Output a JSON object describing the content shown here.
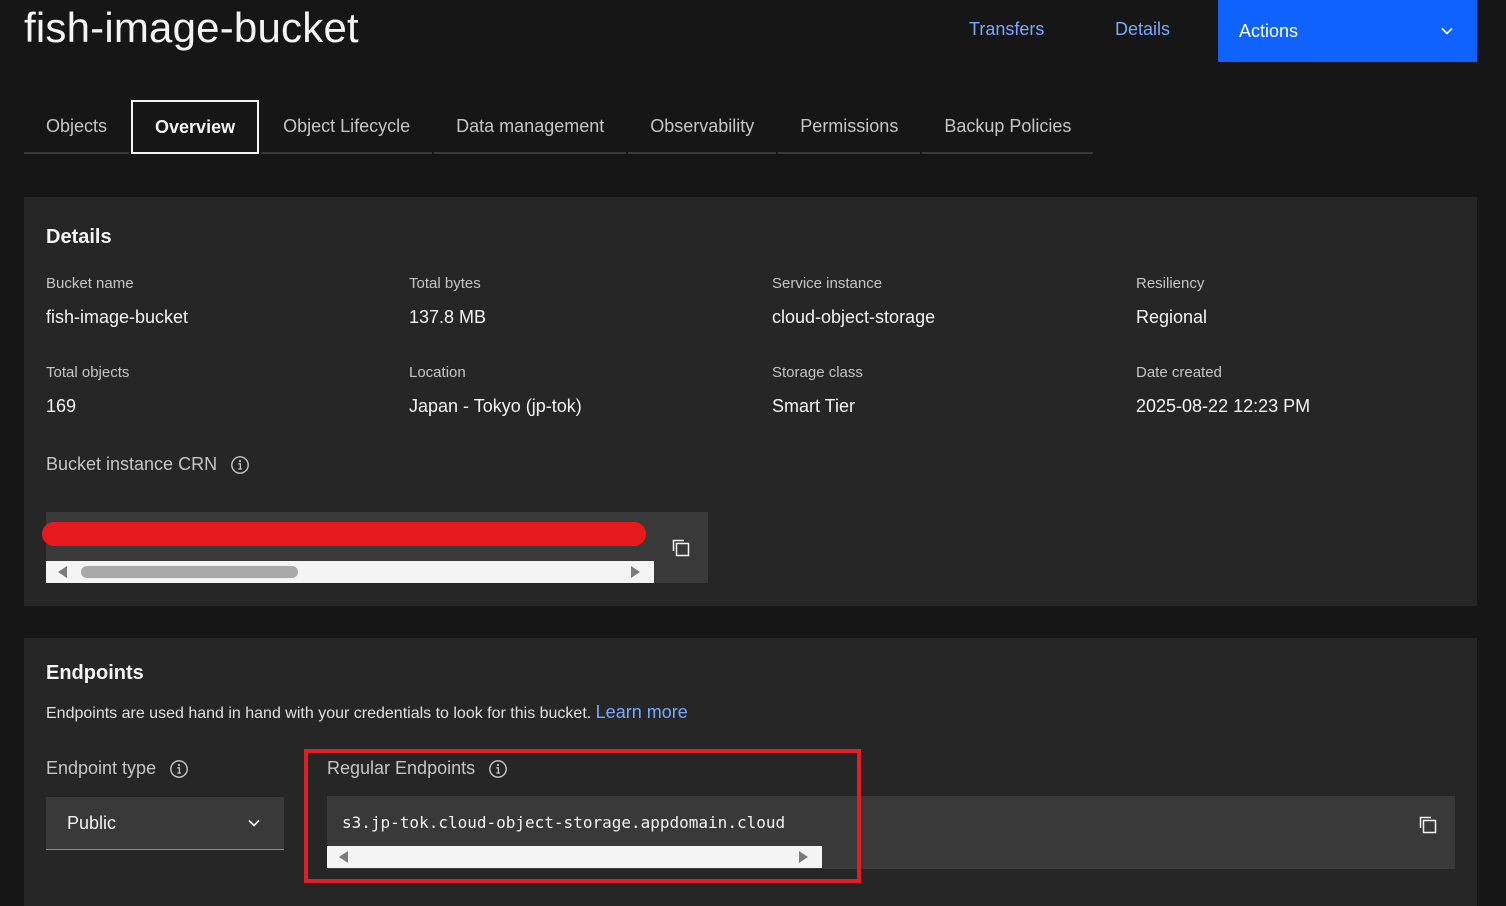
{
  "header": {
    "title": "fish-image-bucket",
    "links": [
      "Transfers",
      "Details"
    ],
    "actions_label": "Actions"
  },
  "tabs": [
    {
      "label": "Objects",
      "selected": false
    },
    {
      "label": "Overview",
      "selected": true
    },
    {
      "label": "Object Lifecycle",
      "selected": false
    },
    {
      "label": "Data management",
      "selected": false
    },
    {
      "label": "Observability",
      "selected": false
    },
    {
      "label": "Permissions",
      "selected": false
    },
    {
      "label": "Backup Policies",
      "selected": false
    }
  ],
  "details": {
    "title": "Details",
    "fields": [
      {
        "label": "Bucket name",
        "value": "fish-image-bucket"
      },
      {
        "label": "Total bytes",
        "value": "137.8 MB"
      },
      {
        "label": "Service instance",
        "value": "cloud-object-storage"
      },
      {
        "label": "Resiliency",
        "value": "Regional"
      },
      {
        "label": "Total objects",
        "value": "169"
      },
      {
        "label": "Location",
        "value": "Japan - Tokyo (jp-tok)"
      },
      {
        "label": "Storage class",
        "value": "Smart Tier"
      },
      {
        "label": "Date created",
        "value": "2025-08-22 12:23 PM"
      }
    ],
    "crn_label": "Bucket instance CRN"
  },
  "endpoints": {
    "title": "Endpoints",
    "description": "Endpoints are used hand in hand with your credentials to look for this bucket.",
    "learn_more": "Learn more",
    "type_label": "Endpoint type",
    "type_value": "Public",
    "regular_label": "Regular Endpoints",
    "regular_value": "s3.jp-tok.cloud-object-storage.appdomain.cloud"
  },
  "colors": {
    "background": "#161616",
    "panel": "#262626",
    "field": "#393939",
    "link": "#78a9ff",
    "primary_button": "#0f62fe",
    "annotation_red": "#e01e24"
  }
}
